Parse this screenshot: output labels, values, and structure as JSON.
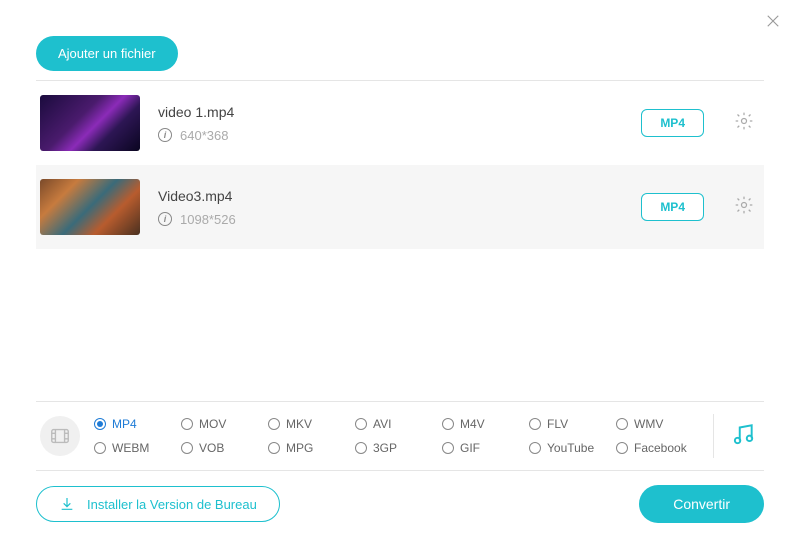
{
  "header": {
    "add_file_label": "Ajouter un fichier"
  },
  "files": [
    {
      "name": "video 1.mp4",
      "dimensions": "640*368",
      "format_badge": "MP4",
      "selected": false
    },
    {
      "name": "Video3.mp4",
      "dimensions": "1098*526",
      "format_badge": "MP4",
      "selected": true
    }
  ],
  "format_options": {
    "row1": [
      "MP4",
      "MOV",
      "MKV",
      "AVI",
      "M4V",
      "FLV",
      "WMV"
    ],
    "row2": [
      "WEBM",
      "VOB",
      "MPG",
      "3GP",
      "GIF",
      "YouTube",
      "Facebook"
    ],
    "selected": "MP4"
  },
  "footer": {
    "install_label": "Installer la Version de Bureau",
    "convert_label": "Convertir"
  }
}
